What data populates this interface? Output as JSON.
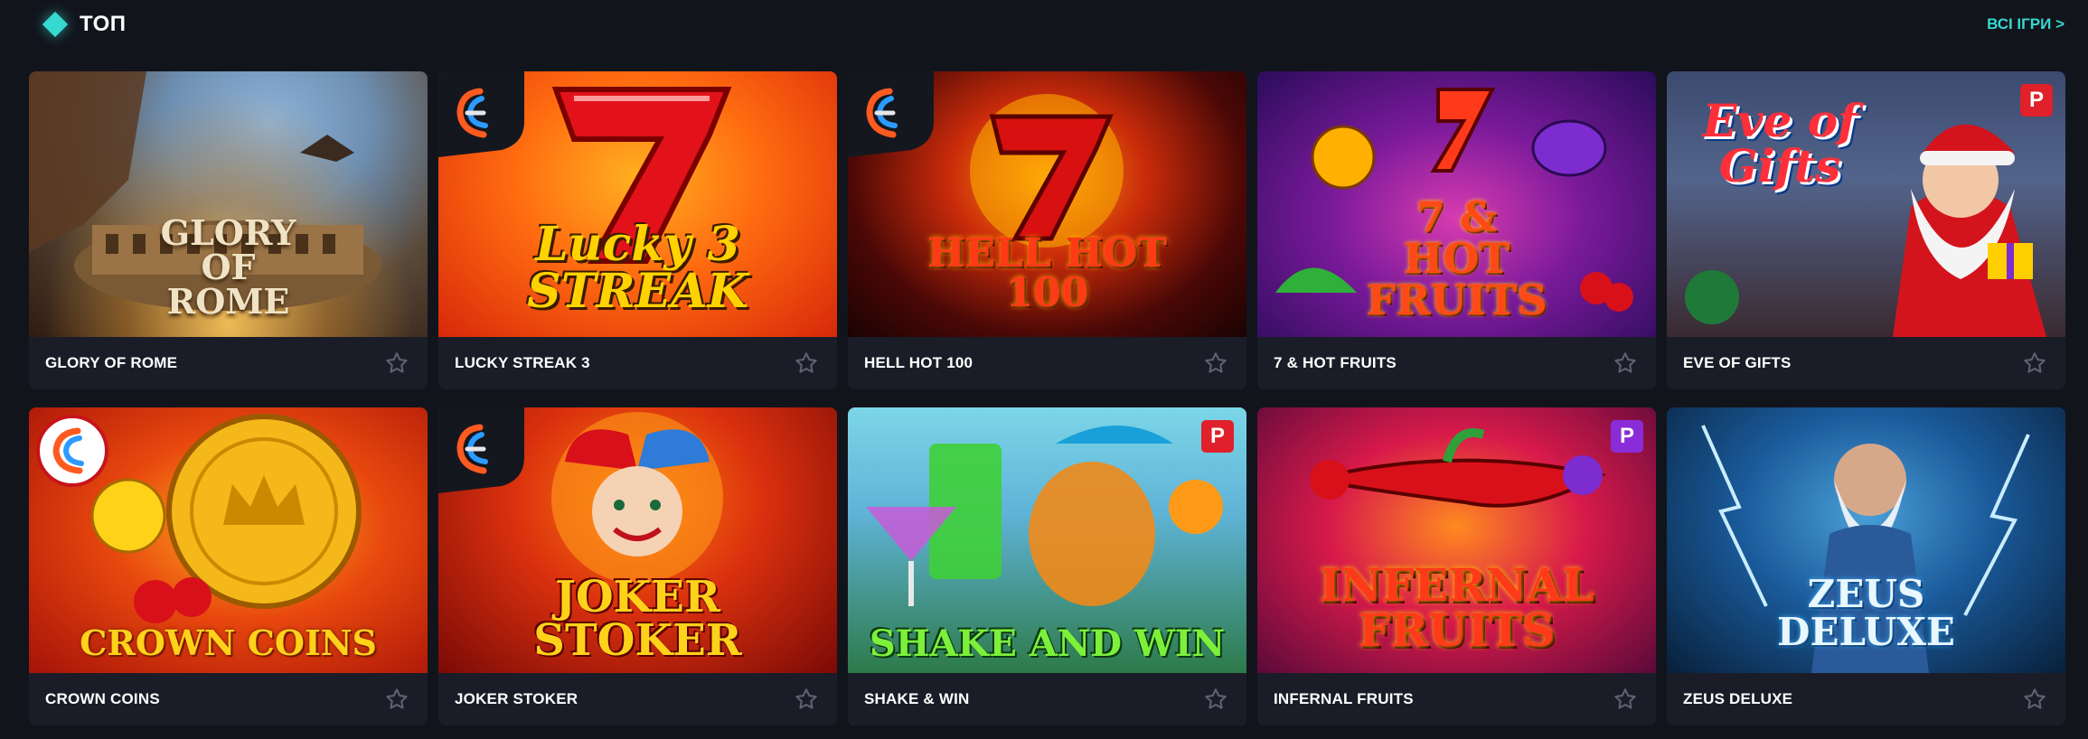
{
  "header": {
    "title": "ТОП",
    "all_games": "ВСІ ІГРИ >"
  },
  "colors": {
    "background": "#12141c",
    "accent": "#36d8cf",
    "card_footer": "#1a1d27"
  },
  "games": [
    {
      "name": "GLORY OF ROME",
      "art_title": "GLORY\nOF\nROME"
    },
    {
      "name": "LUCKY STREAK 3",
      "art_title": "Lucky 3\nSTREAK"
    },
    {
      "name": "HELL HOT 100",
      "art_title": "HELL HOT\n100"
    },
    {
      "name": "7 & HOT FRUITS",
      "art_title": "7 &\nHOT\nFRUITS"
    },
    {
      "name": "EVE OF GIFTS",
      "art_title": "Eve of\nGifts"
    },
    {
      "name": "CROWN COINS",
      "art_title": "CROWN COINS"
    },
    {
      "name": "JOKER STOKER",
      "art_title": "JOKER\nSTOKER"
    },
    {
      "name": "SHAKE & WIN",
      "art_title": "SHAKE AND WIN"
    },
    {
      "name": "INFERNAL FRUITS",
      "art_title": "INFERNAL\nFRUITS"
    },
    {
      "name": "ZEUS DELUXE",
      "art_title": "ZEUS\nDELUXE"
    }
  ],
  "badges": {
    "promo_letter": "P"
  },
  "icons": {
    "favorite": "star-outline-icon",
    "provider": "provider-logo-icon",
    "promo": "promo-badge-icon"
  }
}
